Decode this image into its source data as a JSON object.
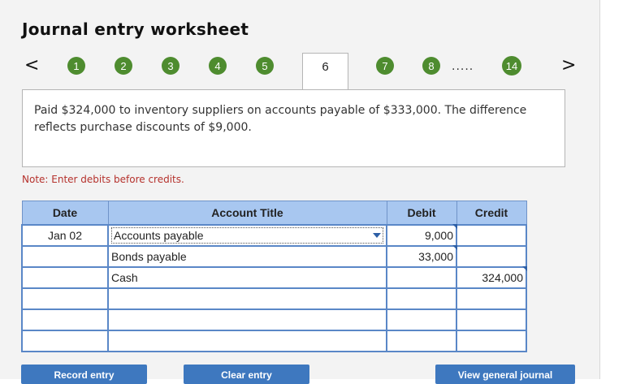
{
  "header": {
    "title": "Journal entry worksheet"
  },
  "nav": {
    "prev": "<",
    "next": ">",
    "steps": [
      "1",
      "2",
      "3",
      "4",
      "5",
      "6",
      "7",
      "8",
      "14"
    ],
    "active": "6",
    "ellipsis": "....."
  },
  "description": "Paid $324,000 to inventory suppliers on accounts payable of $333,000. The difference reflects purchase discounts of $9,000.",
  "note": "Note: Enter debits before credits.",
  "table": {
    "headers": {
      "date": "Date",
      "account": "Account Title",
      "debit": "Debit",
      "credit": "Credit"
    },
    "rows": [
      {
        "date": "Jan 02",
        "account": "Accounts payable",
        "debit": "9,000",
        "credit": ""
      },
      {
        "date": "",
        "account": "Bonds payable",
        "debit": "33,000",
        "credit": ""
      },
      {
        "date": "",
        "account": "Cash",
        "debit": "",
        "credit": "324,000"
      },
      {
        "date": "",
        "account": "",
        "debit": "",
        "credit": ""
      },
      {
        "date": "",
        "account": "",
        "debit": "",
        "credit": ""
      },
      {
        "date": "",
        "account": "",
        "debit": "",
        "credit": ""
      }
    ]
  },
  "buttons": {
    "record": "Record entry",
    "clear": "Clear entry",
    "view": "View general journal"
  },
  "colors": {
    "step": "#4e8c2f",
    "header": "#a8c7f0",
    "border": "#5a87c7",
    "button": "#3e78bf",
    "note": "#b5312c"
  }
}
